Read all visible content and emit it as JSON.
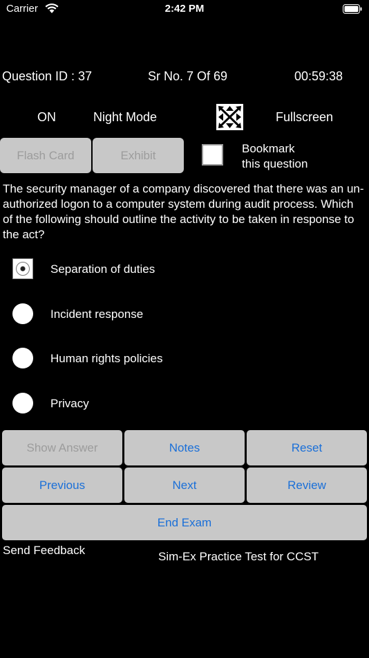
{
  "status_bar": {
    "carrier": "Carrier",
    "time": "2:42 PM"
  },
  "info": {
    "question_id": "Question ID : 37",
    "sr_no": "Sr No. 7 Of 69",
    "timer": "00:59:38"
  },
  "mode": {
    "on_label": "ON",
    "night_mode_label": "Night Mode",
    "fullscreen_label": "Fullscreen"
  },
  "toolbar": {
    "flash_card": "Flash Card",
    "exhibit": "Exhibit",
    "bookmark_line1": "Bookmark",
    "bookmark_line2": "this question"
  },
  "question": {
    "text": "The security manager of a company discovered that there was an un-authorized logon to a computer system during audit process. Which of the following should outline the activity to be taken in response to the act?"
  },
  "options": [
    {
      "label": "Separation of duties",
      "selected": true
    },
    {
      "label": "Incident response",
      "selected": false
    },
    {
      "label": "Human rights policies",
      "selected": false
    },
    {
      "label": "Privacy",
      "selected": false
    }
  ],
  "actions": {
    "show_answer": "Show Answer",
    "notes": "Notes",
    "reset": "Reset",
    "previous": "Previous",
    "next": "Next",
    "review": "Review",
    "end_exam": "End Exam"
  },
  "footer": {
    "send_feedback": "Send Feedback",
    "app_title": "Sim-Ex Practice Test for CCST"
  },
  "colors": {
    "background": "#000000",
    "button_bg": "#c8c8c8",
    "button_text": "#1a6fd8",
    "disabled_text": "#9c9c9c"
  }
}
